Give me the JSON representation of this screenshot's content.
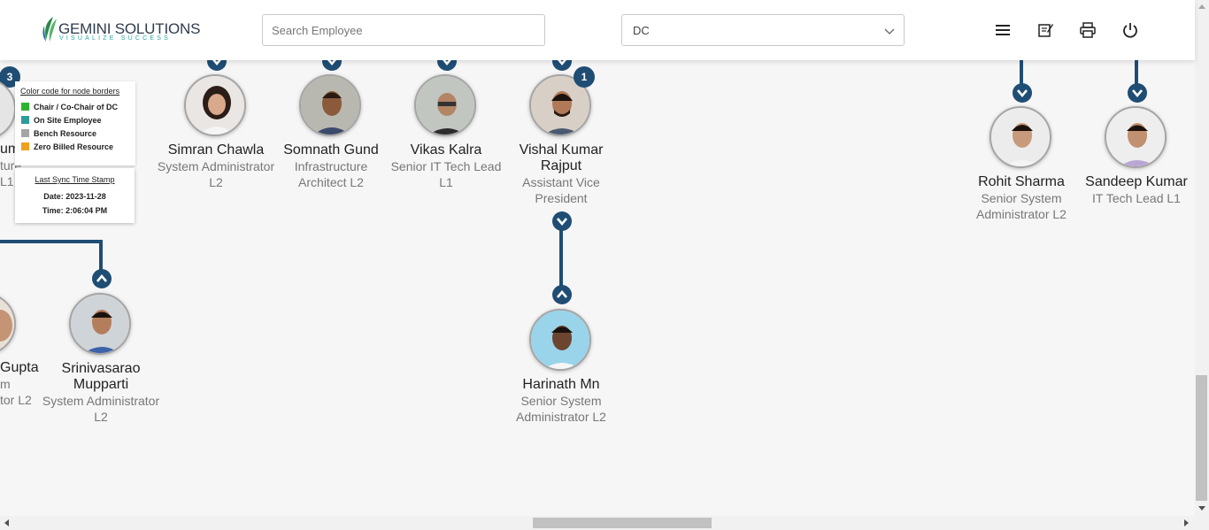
{
  "header": {
    "logo_title": "GEMINI SOLUTIONS",
    "logo_tagline": "VISUALIZE SUCCESS",
    "search_placeholder": "Search Employee",
    "department_value": "DC",
    "icons": [
      "menu-icon",
      "notes-icon",
      "print-icon",
      "power-icon"
    ]
  },
  "legend": {
    "heading": "Color code for node borders",
    "items": [
      {
        "label": "Chair / Co-Chair of DC",
        "color": "#2db52d"
      },
      {
        "label": "On Site Employee",
        "color": "#2f9b9b"
      },
      {
        "label": "Bench Resource",
        "color": "#a5a5a5"
      },
      {
        "label": "Zero Billed Resource",
        "color": "#f0a020"
      }
    ]
  },
  "sync": {
    "heading": "Last Sync Time Stamp",
    "date": "Date: 2023-11-28",
    "time": "Time: 2:06:04 PM"
  },
  "nodes": {
    "partial_left_top": {
      "name": "um",
      "title": "ture",
      "title2": "L1",
      "badge": "3"
    },
    "simran": {
      "name": "Simran Chawla",
      "title": "System Administrator L2"
    },
    "somnath": {
      "name": "Somnath Gund",
      "title": "Infrastructure Architect L2"
    },
    "vikas": {
      "name": "Vikas Kalra",
      "title": "Senior IT Tech Lead L1"
    },
    "vishal": {
      "name": "Vishal Kumar Rajput",
      "title": "Assistant Vice President",
      "badge": "1"
    },
    "rohit": {
      "name": "Rohit Sharma",
      "title": "Senior System Administrator L2"
    },
    "sandeep": {
      "name": "Sandeep Kumar",
      "title": "IT Tech Lead L1"
    },
    "partial_left_bottom": {
      "name": "Gupta",
      "title": "m",
      "title2": "tor L2"
    },
    "srinivasarao": {
      "name": "Srinivasarao Mupparti",
      "title": "System Administrator L2"
    },
    "harinath": {
      "name": "Harinath Mn",
      "title": "Senior System Administrator L2"
    }
  },
  "colors": {
    "accent": "#1f4d74",
    "bench_border": "#a5a5a5"
  }
}
